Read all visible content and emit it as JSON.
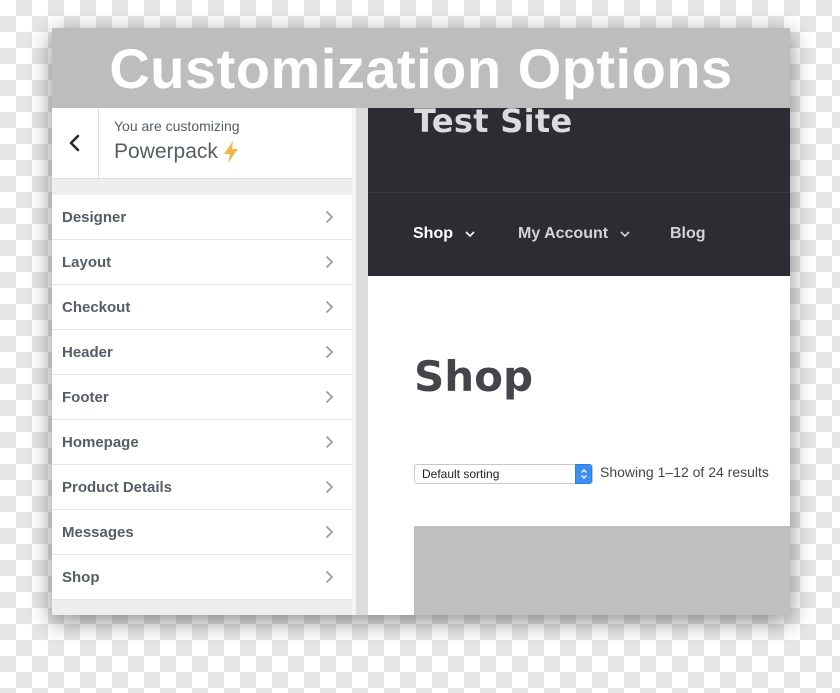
{
  "banner": {
    "title": "Customization Options"
  },
  "customizer": {
    "subtitle": "You are customizing",
    "theme_name": "Powerpack",
    "items": [
      {
        "label": "Designer"
      },
      {
        "label": "Layout"
      },
      {
        "label": "Checkout"
      },
      {
        "label": "Header"
      },
      {
        "label": "Footer"
      },
      {
        "label": "Homepage"
      },
      {
        "label": "Product Details"
      },
      {
        "label": "Messages"
      },
      {
        "label": "Shop"
      }
    ]
  },
  "preview": {
    "site_title": "Test Site",
    "nav": [
      {
        "label": "Shop",
        "has_dropdown": true
      },
      {
        "label": "My Account",
        "has_dropdown": true
      },
      {
        "label": "Blog",
        "has_dropdown": false
      }
    ],
    "page_title": "Shop",
    "sorting": {
      "selected": "Default sorting"
    },
    "result_count": "Showing 1–12 of 24 results"
  },
  "colors": {
    "header_bg": "#2c2d33",
    "banner_bg": "#bdbdbd",
    "bolt": "#f0b849",
    "select_accent": "#3b8ff0"
  },
  "icons": {
    "back": "chevron-left-icon",
    "item_arrow": "chevron-right-icon",
    "nav_dropdown": "chevron-down-icon",
    "theme_badge": "lightning-bolt-icon"
  }
}
